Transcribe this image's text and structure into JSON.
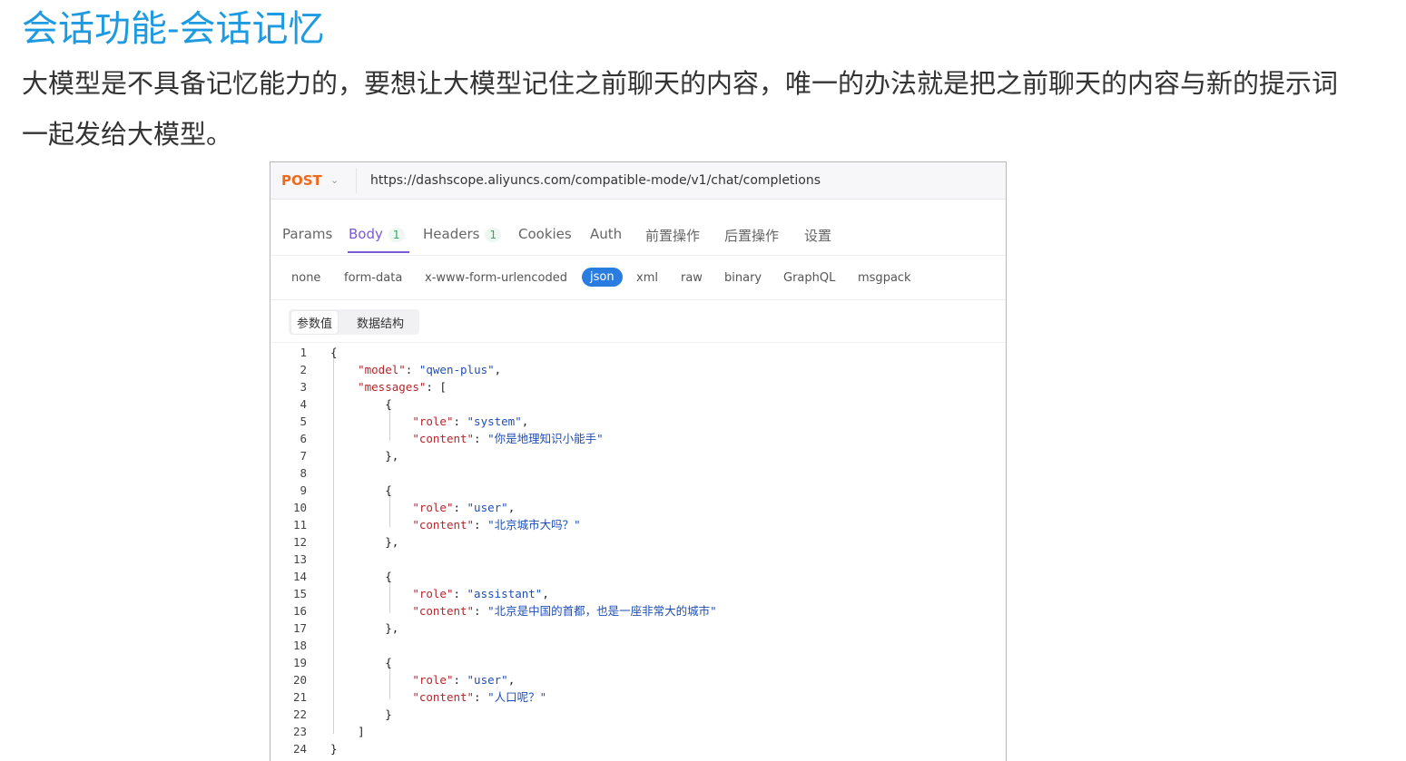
{
  "doc": {
    "title": "会话功能-会话记忆",
    "paragraph": "大模型是不具备记忆能力的，要想让大模型记住之前聊天的内容，唯一的办法就是把之前聊天的内容与新的提示词一起发给大模型。"
  },
  "request": {
    "method": "POST",
    "url": "https://dashscope.aliyuncs.com/compatible-mode/v1/chat/completions"
  },
  "tabs": [
    {
      "label": "Params",
      "badge": ""
    },
    {
      "label": "Body",
      "badge": "1"
    },
    {
      "label": "Headers",
      "badge": "1"
    },
    {
      "label": "Cookies",
      "badge": ""
    },
    {
      "label": "Auth",
      "badge": ""
    },
    {
      "label": "前置操作",
      "badge": ""
    },
    {
      "label": "后置操作",
      "badge": ""
    },
    {
      "label": "设置",
      "badge": ""
    }
  ],
  "active_tab": "Body",
  "body_types": [
    "none",
    "form-data",
    "x-www-form-urlencoded",
    "json",
    "xml",
    "raw",
    "binary",
    "GraphQL",
    "msgpack"
  ],
  "active_body_type": "json",
  "modes": [
    "参数值",
    "数据结构"
  ],
  "active_mode": "参数值",
  "code_lines": [
    {
      "n": "1",
      "text": "{"
    },
    {
      "n": "2",
      "text": "    \"model\": \"qwen-plus\","
    },
    {
      "n": "3",
      "text": "    \"messages\": ["
    },
    {
      "n": "4",
      "text": "        {"
    },
    {
      "n": "5",
      "text": "            \"role\": \"system\","
    },
    {
      "n": "6",
      "text": "            \"content\": \"你是地理知识小能手\""
    },
    {
      "n": "7",
      "text": "        },"
    },
    {
      "n": "8",
      "text": ""
    },
    {
      "n": "9",
      "text": "        {"
    },
    {
      "n": "10",
      "text": "            \"role\": \"user\","
    },
    {
      "n": "11",
      "text": "            \"content\": \"北京城市大吗？\""
    },
    {
      "n": "12",
      "text": "        },"
    },
    {
      "n": "13",
      "text": ""
    },
    {
      "n": "14",
      "text": "        {"
    },
    {
      "n": "15",
      "text": "            \"role\": \"assistant\","
    },
    {
      "n": "16",
      "text": "            \"content\": \"北京是中国的首都，也是一座非常大的城市\""
    },
    {
      "n": "17",
      "text": "        },"
    },
    {
      "n": "18",
      "text": ""
    },
    {
      "n": "19",
      "text": "        {"
    },
    {
      "n": "20",
      "text": "            \"role\": \"user\","
    },
    {
      "n": "21",
      "text": "            \"content\": \"人口呢？\""
    },
    {
      "n": "22",
      "text": "        }"
    },
    {
      "n": "23",
      "text": "    ]"
    },
    {
      "n": "24",
      "text": "}"
    }
  ]
}
